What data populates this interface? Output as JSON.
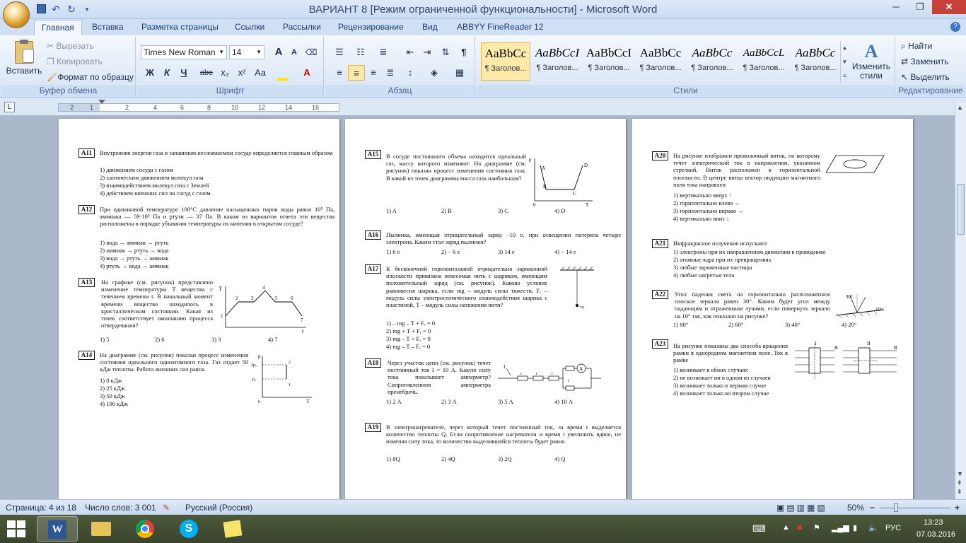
{
  "window": {
    "title": "ВАРИАНТ 8 [Режим ограниченной функциональности]  -  Microsoft Word",
    "minimize": "─",
    "restore": "❐",
    "close": "✕"
  },
  "qat": {
    "save_icon": "save-icon",
    "undo_icon": "undo-icon",
    "redo_icon": "redo-icon"
  },
  "tabs": [
    "Главная",
    "Вставка",
    "Разметка страницы",
    "Ссылки",
    "Рассылки",
    "Рецензирование",
    "Вид",
    "ABBYY FineReader 12"
  ],
  "ribbon": {
    "clipboard": {
      "label": "Буфер обмена",
      "paste": "Вставить",
      "cut": "Вырезать",
      "copy": "Копировать",
      "format_painter": "Формат по образцу"
    },
    "font": {
      "label": "Шрифт",
      "font_name": "Times New Roman",
      "font_size": "14",
      "bold": "Ж",
      "italic": "К",
      "underline": "Ч",
      "strike": "abe",
      "subscript": "x₂",
      "superscript": "x²",
      "case": "Aa",
      "grow": "A",
      "shrink": "A"
    },
    "paragraph": {
      "label": "Абзац"
    },
    "styles": {
      "label": "Стили",
      "items": [
        {
          "sample": "AaBbCc",
          "name": "¶ Заголов..."
        },
        {
          "sample": "AaBbCcI",
          "name": "¶ Заголов..."
        },
        {
          "sample": "AaBbCcI",
          "name": "¶ Заголов..."
        },
        {
          "sample": "AaBbCc",
          "name": "¶ Заголов..."
        },
        {
          "sample": "AaBbCc",
          "name": "¶ Заголов..."
        },
        {
          "sample": "AaBbCcL",
          "name": "¶ Заголов..."
        },
        {
          "sample": "AaBbCc",
          "name": "¶ Заголов..."
        }
      ],
      "change": "Изменить стили"
    },
    "editing": {
      "label": "Редактирование",
      "find": "Найти",
      "replace": "Заменить",
      "select": "Выделить"
    }
  },
  "ruler": {
    "marks": [
      "2",
      "1",
      "2",
      "4",
      "6",
      "8",
      "10",
      "12",
      "14",
      "16"
    ]
  },
  "page1": {
    "A11": {
      "num": "А11",
      "text": "Внутренняя энергия газа в запаянном несжимаемом сосуде определяется главным образом",
      "opts": [
        "1)  движением сосуда с газом",
        "2)  хаотическим движением молекул газа",
        "3)  взаимодействием молекул газа с Землей",
        "4)  действием внешних сил на сосуд с газом"
      ]
    },
    "A12": {
      "num": "А12",
      "text": "При одинаковой температуре 100°С давление насыщенных паров воды равно 10⁵ Па, аммиака — 59·10⁵ Па и ртути — 37 Па. В каком из вариантов ответа эти вещества расположены в порядке убывания температуры их кипения в открытом сосуде?",
      "opts": [
        "1)  вода → аммиак → ртуть",
        "2)  аммиак → ртуть → вода",
        "3)  вода → ртуть → аммиак",
        "4)  ртуть → вода → аммиак"
      ]
    },
    "A13": {
      "num": "А13",
      "text": "На графике (см. рисунок) представлено изменение температуры T вещества с течением времени t. В начальный момент времени вещество находилось в кристаллическом состоянии. Какая из точек соответствует окончанию процесса отвердевания?",
      "opts": [
        "1)  5",
        "2)  6",
        "3)  3",
        "4)  7"
      ],
      "axis_y": "T",
      "axis_x": "t",
      "points": [
        "1",
        "2",
        "3",
        "4",
        "5",
        "6",
        "7"
      ]
    },
    "A14": {
      "num": "А14",
      "text": "На диаграмме (см. рисунок) показан процесс изменения состояния идеального одноатомного газа. Газ отдает 50 кДж теплоты. Работа внешних сил равна",
      "opts": [
        "1)  0 кДж",
        "2)  25 кДж",
        "3)  50 кДж",
        "4)  100 кДж"
      ],
      "axis_y": "p",
      "axis_x": "T",
      "origin": "0",
      "p2": "2p₀",
      "p0": "p₀",
      "pt1": "1",
      "pt2": "2"
    }
  },
  "page2": {
    "A15": {
      "num": "А15",
      "text": "В сосуде постоянного объема находится идеальный газ, массу которого изменяют. На диаграмме (см. рисунок) показан процесс изменения состояния газа. В какой из точек диаграммы масса газа наибольшая?",
      "opts": [
        "1)  A",
        "2)  B",
        "3)  C",
        "4)  D"
      ],
      "axis_y": "p",
      "axis_x": "T",
      "origin": "0",
      "labels": [
        "A",
        "B",
        "C",
        "D"
      ]
    },
    "A16": {
      "num": "А16",
      "text": "Пылинка, имеющая отрицательный заряд −10 е, при освещении потеряла четыре электрона. Каким стал заряд пылинки?",
      "opts": [
        "1)  6 е",
        "2)  − 6 е",
        "3)  14 е",
        "4)  − 14 е"
      ]
    },
    "A17": {
      "num": "А17",
      "text": "К бесконечной горизонтальной отрицательно заряженной плоскости привязана невесомая нить с шариком, имеющим положительный заряд (см. рисунок). Каково условие равновесия шарика, если mg – модуль силы тяжести, Fₑ – модуль силы электростатического взаимодействия шарика с пластиной, T – модуль силы натяжения нити?",
      "opts": [
        "1)  – mg – T + Fₑ = 0",
        "2)  mg + T + Fₑ = 0",
        "3)  mg – T + Fₑ = 0",
        "4)  mg – T – Fₑ = 0"
      ],
      "charge": "+q"
    },
    "A18": {
      "num": "А18",
      "text": "Через участок цепи (см. рисунок) течет постоянный ток I = 10 А. Какую силу тока показывает амперметр? Сопротивлением амперметра пренебречь.",
      "opts": [
        "1)  2 А",
        "2)  3 А",
        "3)  5 А",
        "4)  10 А"
      ],
      "current": "I",
      "r": "r",
      "ammeter": "A"
    },
    "A19": {
      "num": "А19",
      "text": "В электронагревателе, через который течет постоянный ток, за время t выделяется количество теплоты Q. Если сопротивление нагревателя и время t увеличить вдвое, не изменяя силу тока, то количество выделившейся теплоты будет равно",
      "opts": [
        "1)  8Q",
        "2)  4Q",
        "3)  2Q",
        "4)  Q"
      ]
    }
  },
  "page3": {
    "A20": {
      "num": "А20",
      "text": "На рисунке изображен проволочный виток, по которому течет электрический ток в направлении, указанном стрелкой. Виток расположен в горизонтальной плоскости. В центре витка вектор индукции магнитного поля тока направлен",
      "opts": [
        "1)  вертикально вверх ↑",
        "2)  горизонтально влево ←",
        "3)  горизонтально вправо →",
        "4)  вертикально вниз ↓"
      ]
    },
    "A21": {
      "num": "А21",
      "text": "Инфракрасное излучение испускают",
      "opts": [
        "1)  электроны при их направленном движении в проводнике",
        "2)  атомные ядра при их превращениях",
        "3)  любые заряженные частицы",
        "4)  любые нагретые тела"
      ]
    },
    "A22": {
      "num": "А22",
      "text": "Угол падения света на горизонтально расположенное плоское зеркало равен 30°. Каким будет угол между падающим и отраженным лучами, если повернуть зеркало на 10° так, как показано на рисунке?",
      "opts": [
        "1)  80°",
        "2)  60°",
        "3)  40°",
        "4)  20°"
      ],
      "angle1": "30°",
      "angle2": "10°"
    },
    "A23": {
      "num": "А23",
      "text": "На рисунке показаны два способа вращения рамки в однородном магнитном поле. Ток в рамке",
      "opts": [
        "1)  возникает в обоих случаях",
        "2)  не возникает ни в одном из случаев",
        "3)  возникает только в первом случае",
        "4)  возникает только во втором случае"
      ],
      "case1": "I",
      "case2": "II",
      "field": "B"
    }
  },
  "status": {
    "page": "Страница: 4 из 18",
    "words": "Число слов: 3 001",
    "language": "Русский (Россия)",
    "zoom": "50%",
    "zoom_minus": "−",
    "zoom_plus": "+"
  },
  "taskbar": {
    "lang": "РУС",
    "time": "13:23",
    "date": "07.03.2016"
  }
}
